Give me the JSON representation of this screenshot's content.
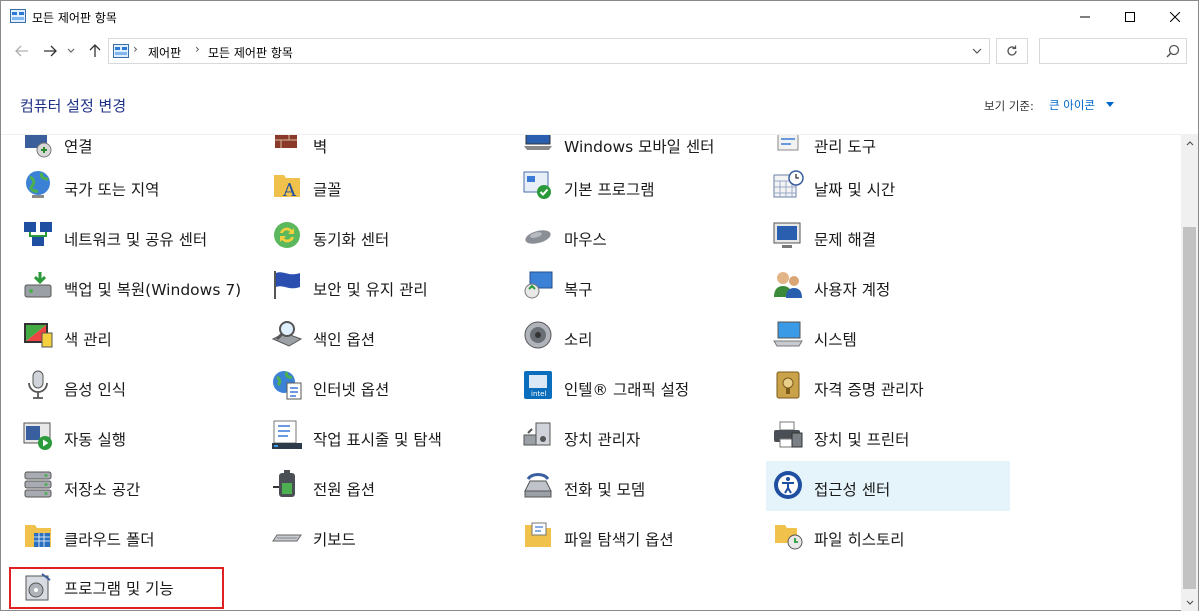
{
  "window": {
    "title": "모든 제어판 항목"
  },
  "address": {
    "crumbs": [
      "제어판",
      "모든 제어판 항목"
    ]
  },
  "search": {
    "placeholder": ""
  },
  "header": {
    "title": "컴퓨터 설정 변경",
    "view_by_label": "보기 기준:",
    "view_by_value": "큰 아이콘"
  },
  "items": [
    {
      "label": "연결",
      "icon": "remoteapp-icon"
    },
    {
      "label": "벽",
      "icon": "firewall-icon"
    },
    {
      "label": "Windows 모바일 센터",
      "icon": "mobility-center-icon"
    },
    {
      "label": "관리 도구",
      "icon": "admin-tools-icon"
    },
    {
      "label": "국가 또는 지역",
      "icon": "region-globe-icon"
    },
    {
      "label": "글꼴",
      "icon": "fonts-icon"
    },
    {
      "label": "기본 프로그램",
      "icon": "default-programs-icon"
    },
    {
      "label": "날짜 및 시간",
      "icon": "date-time-icon"
    },
    {
      "label": "네트워크 및 공유 센터",
      "icon": "network-icon"
    },
    {
      "label": "동기화 센터",
      "icon": "sync-center-icon"
    },
    {
      "label": "마우스",
      "icon": "mouse-icon"
    },
    {
      "label": "문제 해결",
      "icon": "troubleshooting-icon"
    },
    {
      "label": "백업 및 복원(Windows 7)",
      "icon": "backup-icon"
    },
    {
      "label": "보안 및 유지 관리",
      "icon": "security-flag-icon"
    },
    {
      "label": "복구",
      "icon": "recovery-icon"
    },
    {
      "label": "사용자 계정",
      "icon": "user-accounts-icon"
    },
    {
      "label": "색 관리",
      "icon": "color-management-icon"
    },
    {
      "label": "색인 옵션",
      "icon": "indexing-icon"
    },
    {
      "label": "소리",
      "icon": "sound-icon"
    },
    {
      "label": "시스템",
      "icon": "system-icon"
    },
    {
      "label": "음성 인식",
      "icon": "microphone-icon"
    },
    {
      "label": "인터넷 옵션",
      "icon": "internet-options-icon"
    },
    {
      "label": "인텔® 그래픽 설정",
      "icon": "intel-graphics-icon"
    },
    {
      "label": "자격 증명 관리자",
      "icon": "credential-vault-icon"
    },
    {
      "label": "자동 실행",
      "icon": "autoplay-icon"
    },
    {
      "label": "작업 표시줄 및 탐색",
      "icon": "taskbar-icon"
    },
    {
      "label": "장치 관리자",
      "icon": "device-manager-icon"
    },
    {
      "label": "장치 및 프린터",
      "icon": "printer-icon"
    },
    {
      "label": "저장소 공간",
      "icon": "storage-spaces-icon"
    },
    {
      "label": "전원 옵션",
      "icon": "power-battery-icon"
    },
    {
      "label": "전화 및 모뎀",
      "icon": "phone-modem-icon"
    },
    {
      "label": "접근성 센터",
      "icon": "ease-of-access-icon"
    },
    {
      "label": "클라우드 폴더",
      "icon": "work-folders-icon"
    },
    {
      "label": "키보드",
      "icon": "keyboard-icon"
    },
    {
      "label": "파일 탐색기 옵션",
      "icon": "folder-options-icon"
    },
    {
      "label": "파일 히스토리",
      "icon": "file-history-icon"
    },
    {
      "label": "프로그램 및 기능",
      "icon": "programs-features-icon"
    }
  ]
}
